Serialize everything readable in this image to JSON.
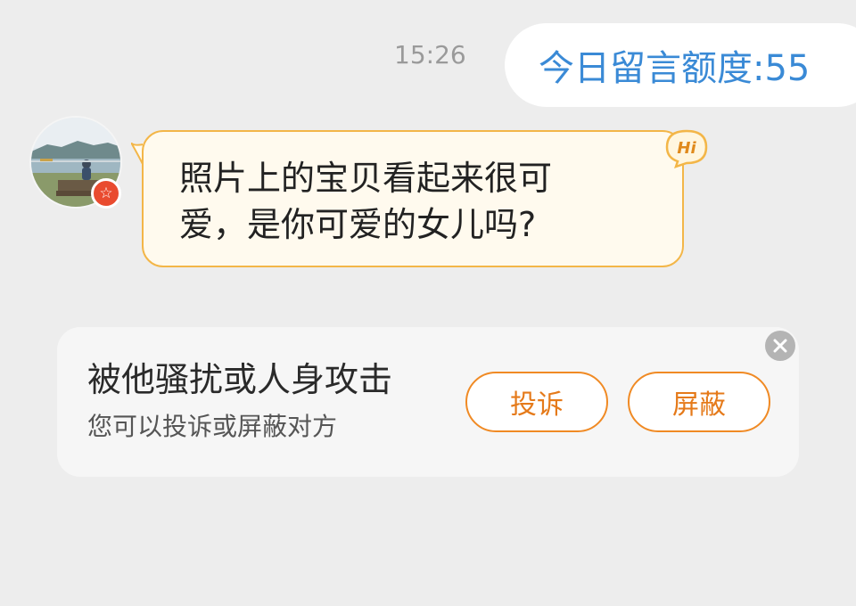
{
  "header": {
    "timestamp": "15:26",
    "quota_label": "今日留言额度:55"
  },
  "message": {
    "avatar_icon": "user-avatar-lakeside-photo",
    "badge_icon": "star-badge-icon",
    "badge_glyph": "☆",
    "text": "照片上的宝贝看起来很可爱，是你可爱的女儿吗?",
    "hi_badge": "Hi",
    "bubble_color": "#fffaee",
    "bubble_border_color": "#f3b648"
  },
  "report": {
    "title": "被他骚扰或人身攻击",
    "subtitle": "您可以投诉或屏蔽对方",
    "report_button": "投诉",
    "block_button": "屏蔽",
    "accent_color": "#f08a24",
    "close_icon": "close-icon"
  }
}
